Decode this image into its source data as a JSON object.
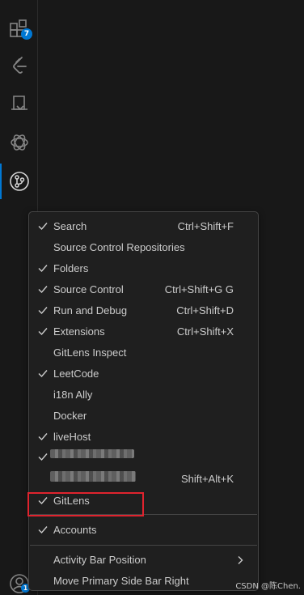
{
  "activity_bar": {
    "items": [
      {
        "name": "extensions",
        "icon": "extensions-icon",
        "badge": "7"
      },
      {
        "name": "leetcode",
        "icon": "leetcode-icon"
      },
      {
        "name": "remote-explorer",
        "icon": "remote-explorer-icon"
      },
      {
        "name": "chatgpt",
        "icon": "chatgpt-icon"
      },
      {
        "name": "source-control",
        "icon": "source-control-icon",
        "active": true
      }
    ],
    "accounts": {
      "icon": "accounts-icon",
      "badge": "1"
    },
    "accent_color": "#0078d4"
  },
  "menu": {
    "items": {
      "search": {
        "label": "Search",
        "checked": true,
        "keybinding": "Ctrl+Shift+F"
      },
      "scm_repos": {
        "label": "Source Control Repositories",
        "checked": false
      },
      "folders": {
        "label": "Folders",
        "checked": true
      },
      "source_control": {
        "label": "Source Control",
        "checked": true,
        "keybinding": "Ctrl+Shift+G G"
      },
      "run_debug": {
        "label": "Run and Debug",
        "checked": true,
        "keybinding": "Ctrl+Shift+D"
      },
      "extensions": {
        "label": "Extensions",
        "checked": true,
        "keybinding": "Ctrl+Shift+X"
      },
      "gitlens_inspect": {
        "label": "GitLens Inspect",
        "checked": false
      },
      "leetcode": {
        "label": "LeetCode",
        "checked": true
      },
      "i18n_ally": {
        "label": "i18n Ally",
        "checked": false
      },
      "docker": {
        "label": "Docker",
        "checked": false
      },
      "livehost": {
        "label": "liveHost",
        "checked": true
      },
      "redacted_1": {
        "checked": true
      },
      "redacted_2": {
        "checked": false,
        "keybinding": "Shift+Alt+K"
      },
      "gitlens": {
        "label": "GitLens",
        "checked": true
      },
      "accounts": {
        "label": "Accounts",
        "checked": true
      },
      "activity_bar_position": {
        "label": "Activity Bar Position",
        "has_submenu": true
      },
      "move_side_bar": {
        "label": "Move Primary Side Bar Right"
      }
    }
  },
  "annotation": {
    "color": "#e0232e"
  },
  "watermark": "CSDN @陈Chen."
}
